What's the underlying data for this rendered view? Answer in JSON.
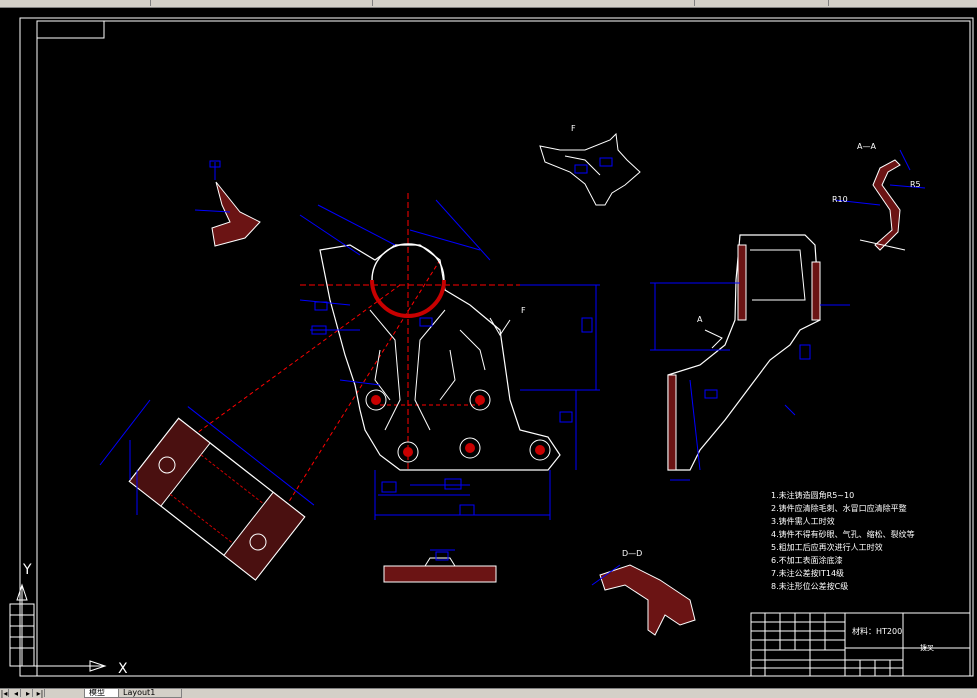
{
  "drawing": {
    "section_labels": {
      "f_view": "F",
      "f_arrow": "F",
      "section_aa": "A—A",
      "section_a_mark": "A",
      "section_dd": "D—D"
    },
    "axis": {
      "x_label": "X",
      "y_label": "Y"
    },
    "dimensions": {
      "r10": "R10",
      "r5": "R5",
      "r6": "R6",
      "r8": "R8",
      "r12": "R12",
      "r17": "R17",
      "d18": "18",
      "d28": "28",
      "d11": "11",
      "d68": "68",
      "d15": "15",
      "d98": "98",
      "d65": "65"
    },
    "notes": [
      "1.未注铸造圆角R5~10",
      "2.铸件应清除毛刺、水冒口应清除平整",
      "3.铸件需人工时效",
      "4.铸件不得有砂眼、气孔、缩松、裂纹等",
      "5.粗加工后应再次进行人工时效",
      "6.不加工表面涂底漆",
      "7.未注公差按IT14级",
      "8.未注形位公差按C级"
    ],
    "title_block": {
      "material": "材料：HT200",
      "part_name": "拨叉"
    }
  },
  "tabs": {
    "nav_first": "|◂",
    "nav_prev": "◂",
    "nav_next": "▸",
    "nav_last": "▸|",
    "model": "模型",
    "layout1": "Layout1"
  },
  "colors": {
    "background": "#000000",
    "outline": "#ffffff",
    "dimension": "#0000ff",
    "hatch": "#c80000",
    "center_line": "#ff0000"
  }
}
